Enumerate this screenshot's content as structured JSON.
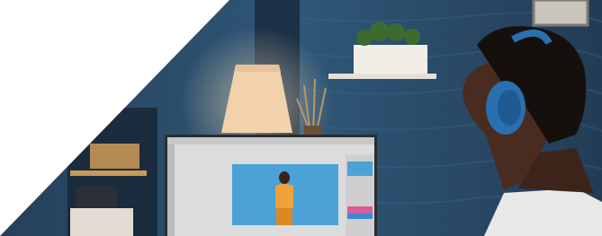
{
  "scene": {
    "subject": "editor-at-desk",
    "palette": {
      "wall": "#2f5778",
      "wall_dark": "#1d3348",
      "lamp_shade": "#f2d2ac",
      "monitor_canvas_bg": "#4aa2d6",
      "model_top": "#f0a13a",
      "headphones": "#2a6fb0",
      "shirt": "#e8e8e6",
      "overlay": "#ffffff"
    },
    "icons": [
      "monitor-icon",
      "lamp-icon",
      "headphones-icon",
      "plant-icon"
    ]
  }
}
